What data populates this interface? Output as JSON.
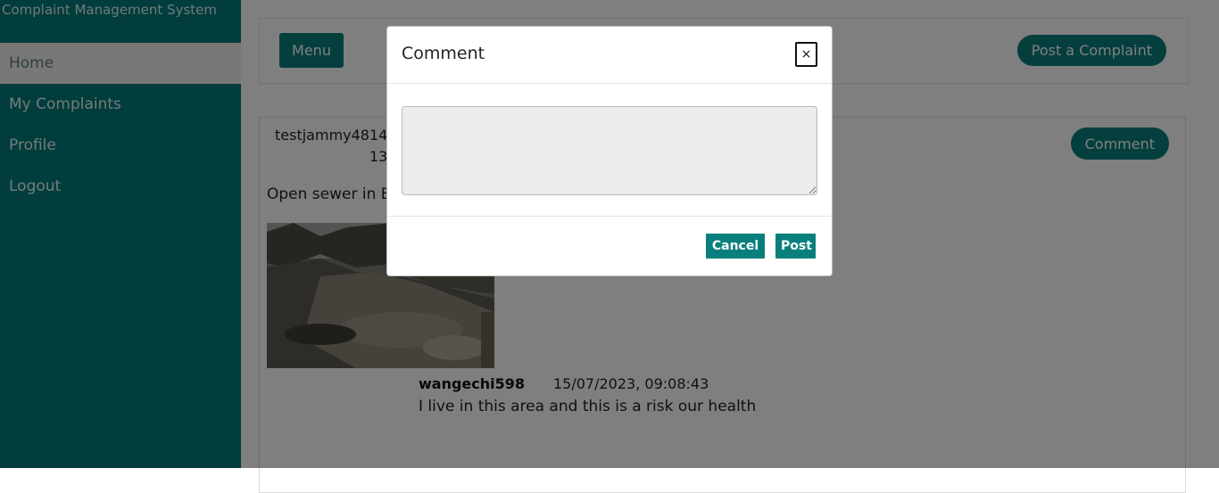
{
  "sidebar": {
    "brand": "Complaint Management System",
    "items": [
      {
        "label": "Home",
        "active": true
      },
      {
        "label": "My Complaints",
        "active": false
      },
      {
        "label": "Profile",
        "active": false
      },
      {
        "label": "Logout",
        "active": false
      }
    ]
  },
  "topbar": {
    "menu_label": "Menu",
    "post_complaint_label": "Post a Complaint"
  },
  "complaint": {
    "user": "testjammy4814/",
    "time": "13:",
    "comment_button": "Comment",
    "description": "Open sewer in E",
    "comment": {
      "author": "wangechi598",
      "date": "15/07/2023, 09:08:43",
      "text": "I live in this area and this is a risk our health"
    }
  },
  "modal": {
    "title": "Comment",
    "close_symbol": "×",
    "textarea_value": "",
    "cancel_label": "Cancel",
    "post_label": "Post"
  },
  "colors": {
    "teal": "#087f7c",
    "sidebar": "#007a78"
  }
}
